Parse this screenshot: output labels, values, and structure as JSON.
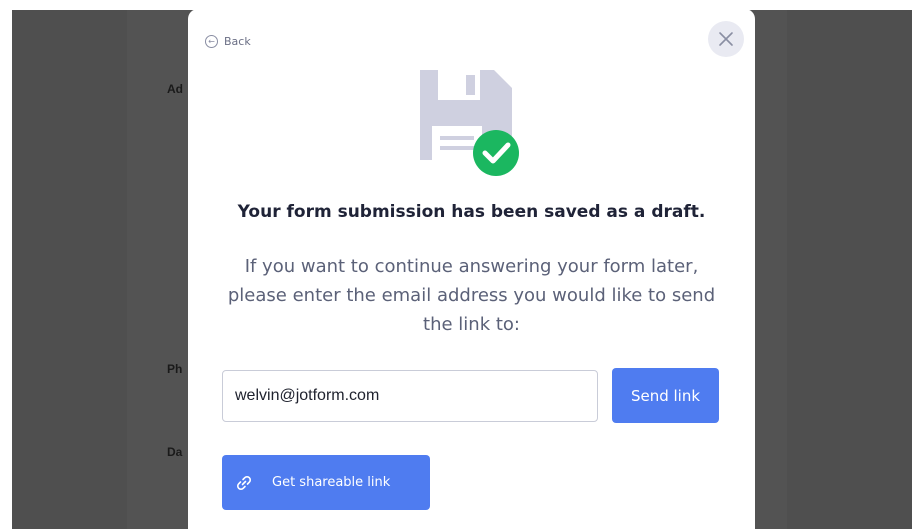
{
  "background_form": {
    "labels": [
      "Ad",
      "Ph",
      "Da"
    ]
  },
  "modal": {
    "back_label": "Back",
    "title": "Your form submission has been saved as a draft.",
    "description": "If you want to continue answering your form later, please enter the email address you would like to send the link to:",
    "email": {
      "value": "welvin@jotform.com"
    },
    "send_label": "Send link",
    "share_label": "Get shareable link"
  },
  "icons": {
    "back": "arrow-left-circle-icon",
    "close": "close-icon",
    "illustration": "floppy-disk-check-icon",
    "share": "link-icon"
  },
  "colors": {
    "accent": "#4f7cf0",
    "success": "#1bb760",
    "overlay": "#4f4f4f",
    "title": "#1f2337",
    "text_muted": "#5b6178"
  }
}
